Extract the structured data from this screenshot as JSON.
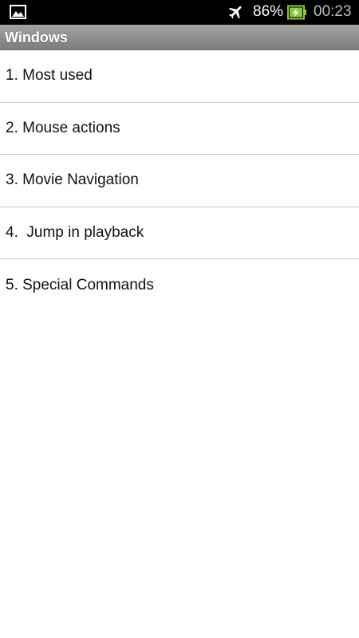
{
  "status_bar": {
    "battery_percent": "86%",
    "clock": "00:23",
    "icons": [
      "picture-icon",
      "airplane-mode-icon",
      "battery-charging-icon"
    ],
    "battery_color": "#8dc63f"
  },
  "title_bar": {
    "title": "Windows"
  },
  "menu": {
    "items": [
      {
        "label": "1. Most used"
      },
      {
        "label": "2. Mouse actions"
      },
      {
        "label": "3. Movie Navigation"
      },
      {
        "label": "4.  Jump in playback"
      },
      {
        "label": "5. Special Commands"
      }
    ]
  }
}
